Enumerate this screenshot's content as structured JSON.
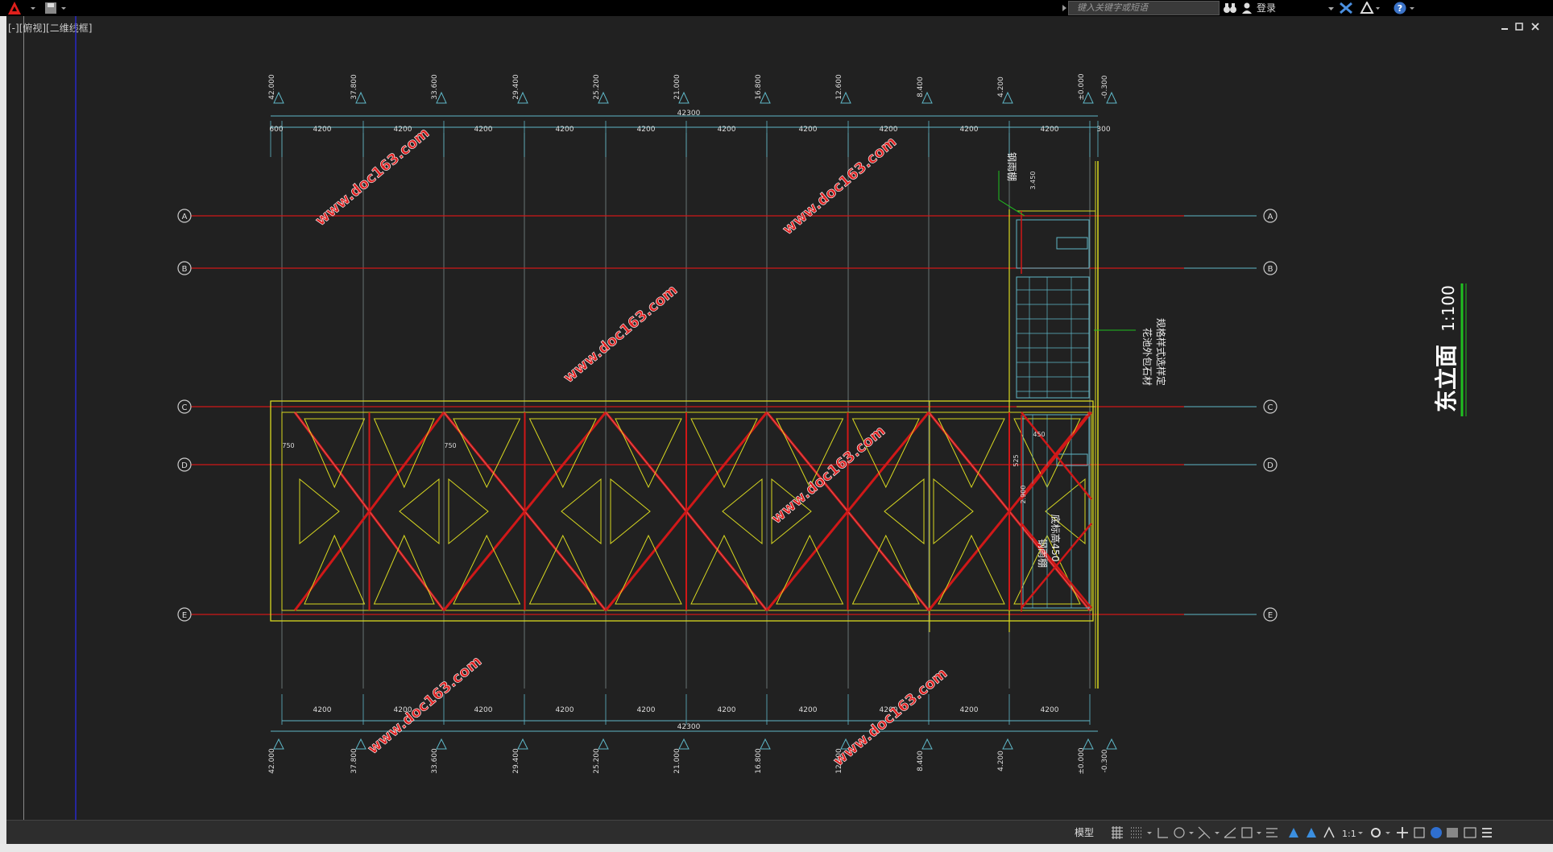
{
  "titlebar": {
    "search_placeholder": "键入关键字或短语",
    "login_label": "登录"
  },
  "viewport": {
    "label": "[-][俯视][二维线框]"
  },
  "drawing": {
    "title": "东立面",
    "scale": "1:100",
    "top_elevations": [
      "42.000",
      "37.800",
      "33.600",
      "29.400",
      "25.200",
      "21.000",
      "16.800",
      "12.600",
      "8.400",
      "4.200",
      "±0.000",
      "-0.300"
    ],
    "bottom_elevations": [
      "42.000",
      "37.800",
      "33.600",
      "29.400",
      "25.200",
      "21.000",
      "16.800",
      "12.600",
      "8.400",
      "4.200",
      "±0.000",
      "-0.300"
    ],
    "top_total": "42300",
    "bottom_total": "42300",
    "top_dims": [
      "600",
      "4200",
      "4200",
      "4200",
      "4200",
      "4200",
      "4200",
      "4200",
      "4200",
      "4200",
      "4200",
      "300"
    ],
    "bottom_dims": [
      "4200",
      "4200",
      "4200",
      "4200",
      "4200",
      "4200",
      "4200",
      "4200",
      "4200",
      "4200"
    ],
    "grid_axes": [
      "A",
      "B",
      "C",
      "D",
      "E"
    ],
    "annotations": {
      "canopy_top": "钢雨棚",
      "canopy_top_elev": "3.450",
      "stone_note_1": "花池外包石材",
      "stone_note_2": "规格样式选样定",
      "canopy_bottom_1": "钢雨棚",
      "canopy_bottom_2": "底标高450",
      "dim_750_a": "750",
      "dim_750_b": "750",
      "dim_450": "450",
      "dim_525": "525",
      "dim_2900": "2.900"
    },
    "watermark": "www.doc163.com"
  },
  "statusbar": {
    "model_label": "模型",
    "scale_label": "1:1"
  },
  "colors": {
    "background": "#212121",
    "grid_red": "#d01818",
    "structure_yellow": "#d8d820",
    "dim_cyan": "#5fb8c8",
    "watermark_red": "#e02020",
    "title_green": "#20c020"
  }
}
